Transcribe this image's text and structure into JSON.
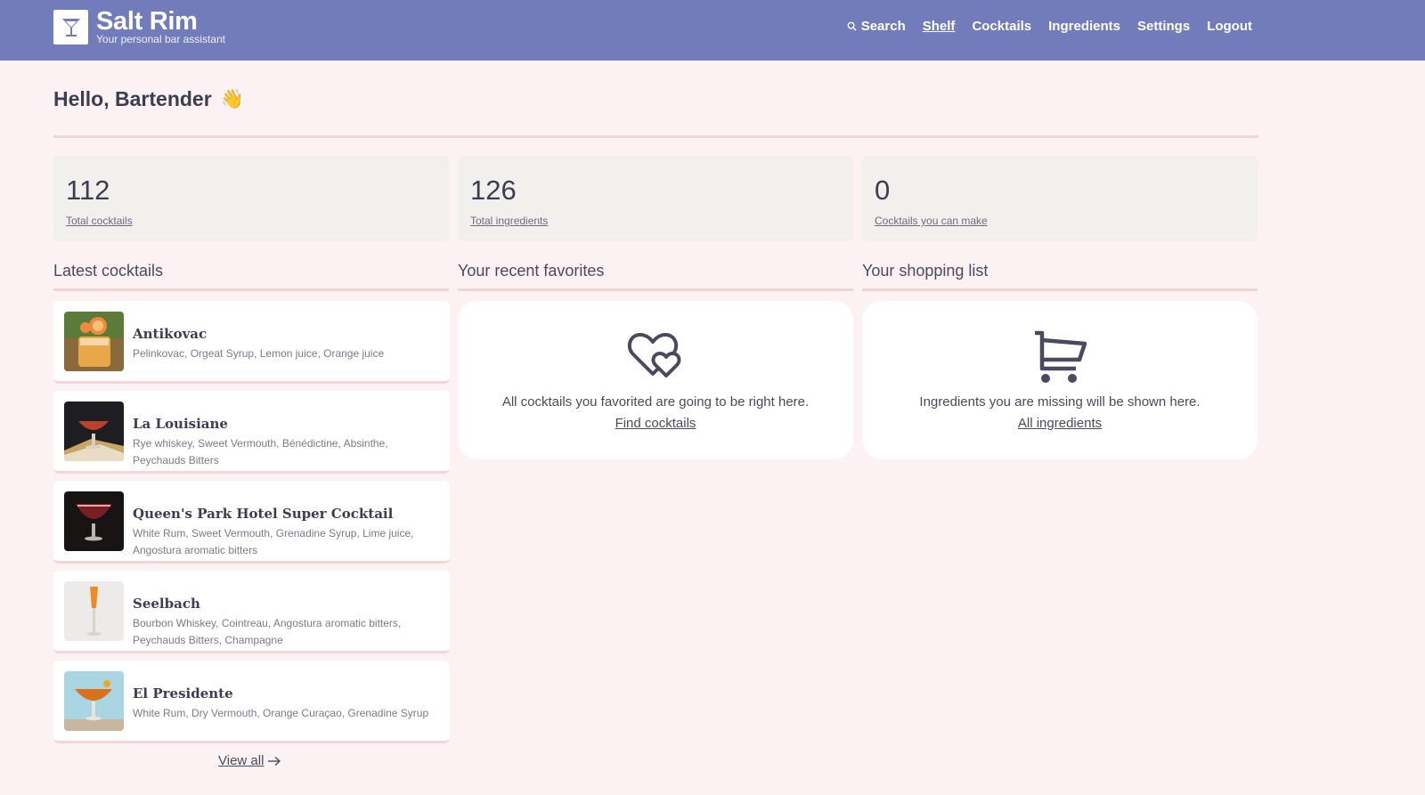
{
  "header": {
    "app_name": "Salt Rim",
    "tagline": "Your personal bar assistant",
    "nav": [
      {
        "label": "Search",
        "icon": "search-icon"
      },
      {
        "label": "Shelf",
        "active": true
      },
      {
        "label": "Cocktails"
      },
      {
        "label": "Ingredients"
      },
      {
        "label": "Settings"
      },
      {
        "label": "Logout"
      }
    ],
    "logo_icon": "cocktail-glass-icon"
  },
  "greeting": {
    "text": "Hello, Bartender",
    "emoji": "👋"
  },
  "stats": [
    {
      "value": "112",
      "label": "Total cocktails"
    },
    {
      "value": "126",
      "label": "Total ingredients"
    },
    {
      "value": "0",
      "label": "Cocktails you can make"
    }
  ],
  "sections": {
    "latest": {
      "title": "Latest cocktails",
      "view_all": "View all",
      "items": [
        {
          "name": "Antikovac",
          "ingredients": "Pelinkovac, Orgeat Syrup, Lemon juice, Orange juice"
        },
        {
          "name": "La Louisiane",
          "ingredients": "Rye whiskey, Sweet Vermouth, Bénédictine, Absinthe, Peychauds Bitters"
        },
        {
          "name": "Queen's Park Hotel Super Cocktail",
          "ingredients": "White Rum, Sweet Vermouth, Grenadine Syrup, Lime juice, Angostura aromatic bitters"
        },
        {
          "name": "Seelbach",
          "ingredients": "Bourbon Whiskey, Cointreau, Angostura aromatic bitters, Peychauds Bitters, Champagne"
        },
        {
          "name": "El Presidente",
          "ingredients": "White Rum, Dry Vermouth, Orange Curaçao, Grenadine Syrup"
        }
      ]
    },
    "favorites": {
      "title": "Your recent favorites",
      "empty_text": "All cocktails you favorited are going to be right here.",
      "link": "Find cocktails",
      "icon": "hearts-icon"
    },
    "shopping": {
      "title": "Your shopping list",
      "empty_text": "Ingredients you are missing will be shown here.",
      "link": "All ingredients",
      "icon": "shopping-cart-icon"
    }
  },
  "colors": {
    "header_bg": "#737cba",
    "page_bg": "#fdf2f3",
    "accent_line": "#f0d4d7",
    "stat_bg": "#f2f0ed"
  }
}
